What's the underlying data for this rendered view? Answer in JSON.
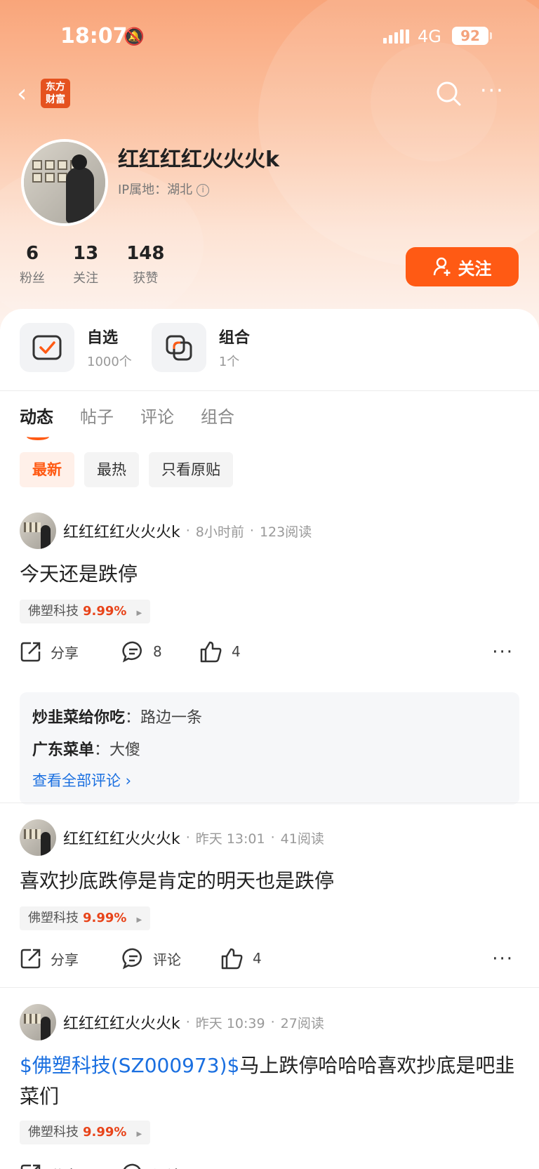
{
  "status": {
    "time": "18:07",
    "network": "4G",
    "battery": "92"
  },
  "nav": {
    "logo_line1": "东方",
    "logo_line2": "财富"
  },
  "profile": {
    "name": "红红红红火火火k",
    "ip": "IP属地：湖北",
    "stats": [
      {
        "num": "6",
        "label": "粉丝"
      },
      {
        "num": "13",
        "label": "关注"
      },
      {
        "num": "148",
        "label": "获赞"
      }
    ],
    "follow_label": "关注"
  },
  "assets": [
    {
      "title": "自选",
      "sub": "1000个"
    },
    {
      "title": "组合",
      "sub": "1个"
    }
  ],
  "tabs": [
    "动态",
    "帖子",
    "评论",
    "组合"
  ],
  "filters": [
    "最新",
    "最热",
    "只看原贴"
  ],
  "posts": [
    {
      "author": "红红红红火火火k",
      "time": "8小时前",
      "reads": "123阅读",
      "text": "今天还是跌停",
      "stock": "佛塑科技",
      "pct": "9.99%",
      "share": "分享",
      "comments": "8",
      "likes": "4",
      "comment_list": [
        {
          "who": "炒韭菜给你吃",
          "text": "路边一条"
        },
        {
          "who": "广东菜单",
          "text": "大傻"
        }
      ],
      "view_all": "查看全部评论"
    },
    {
      "author": "红红红红火火火k",
      "time": "昨天 13:01",
      "reads": "41阅读",
      "text": "喜欢抄底跌停是肯定的明天也是跌停",
      "stock": "佛塑科技",
      "pct": "9.99%",
      "share": "分享",
      "comments": "评论",
      "likes": "4"
    },
    {
      "author": "红红红红火火火k",
      "time": "昨天 10:39",
      "reads": "27阅读",
      "link": "$佛塑科技(SZ000973)$",
      "text": "马上跌停哈哈哈喜欢抄底是吧韭菜们",
      "stock": "佛塑科技",
      "pct": "9.99%",
      "share": "分享",
      "comments": "评论"
    }
  ],
  "colors": {
    "accent": "#ff5a14",
    "link": "#1a6fe0",
    "gain": "#e8441a"
  }
}
